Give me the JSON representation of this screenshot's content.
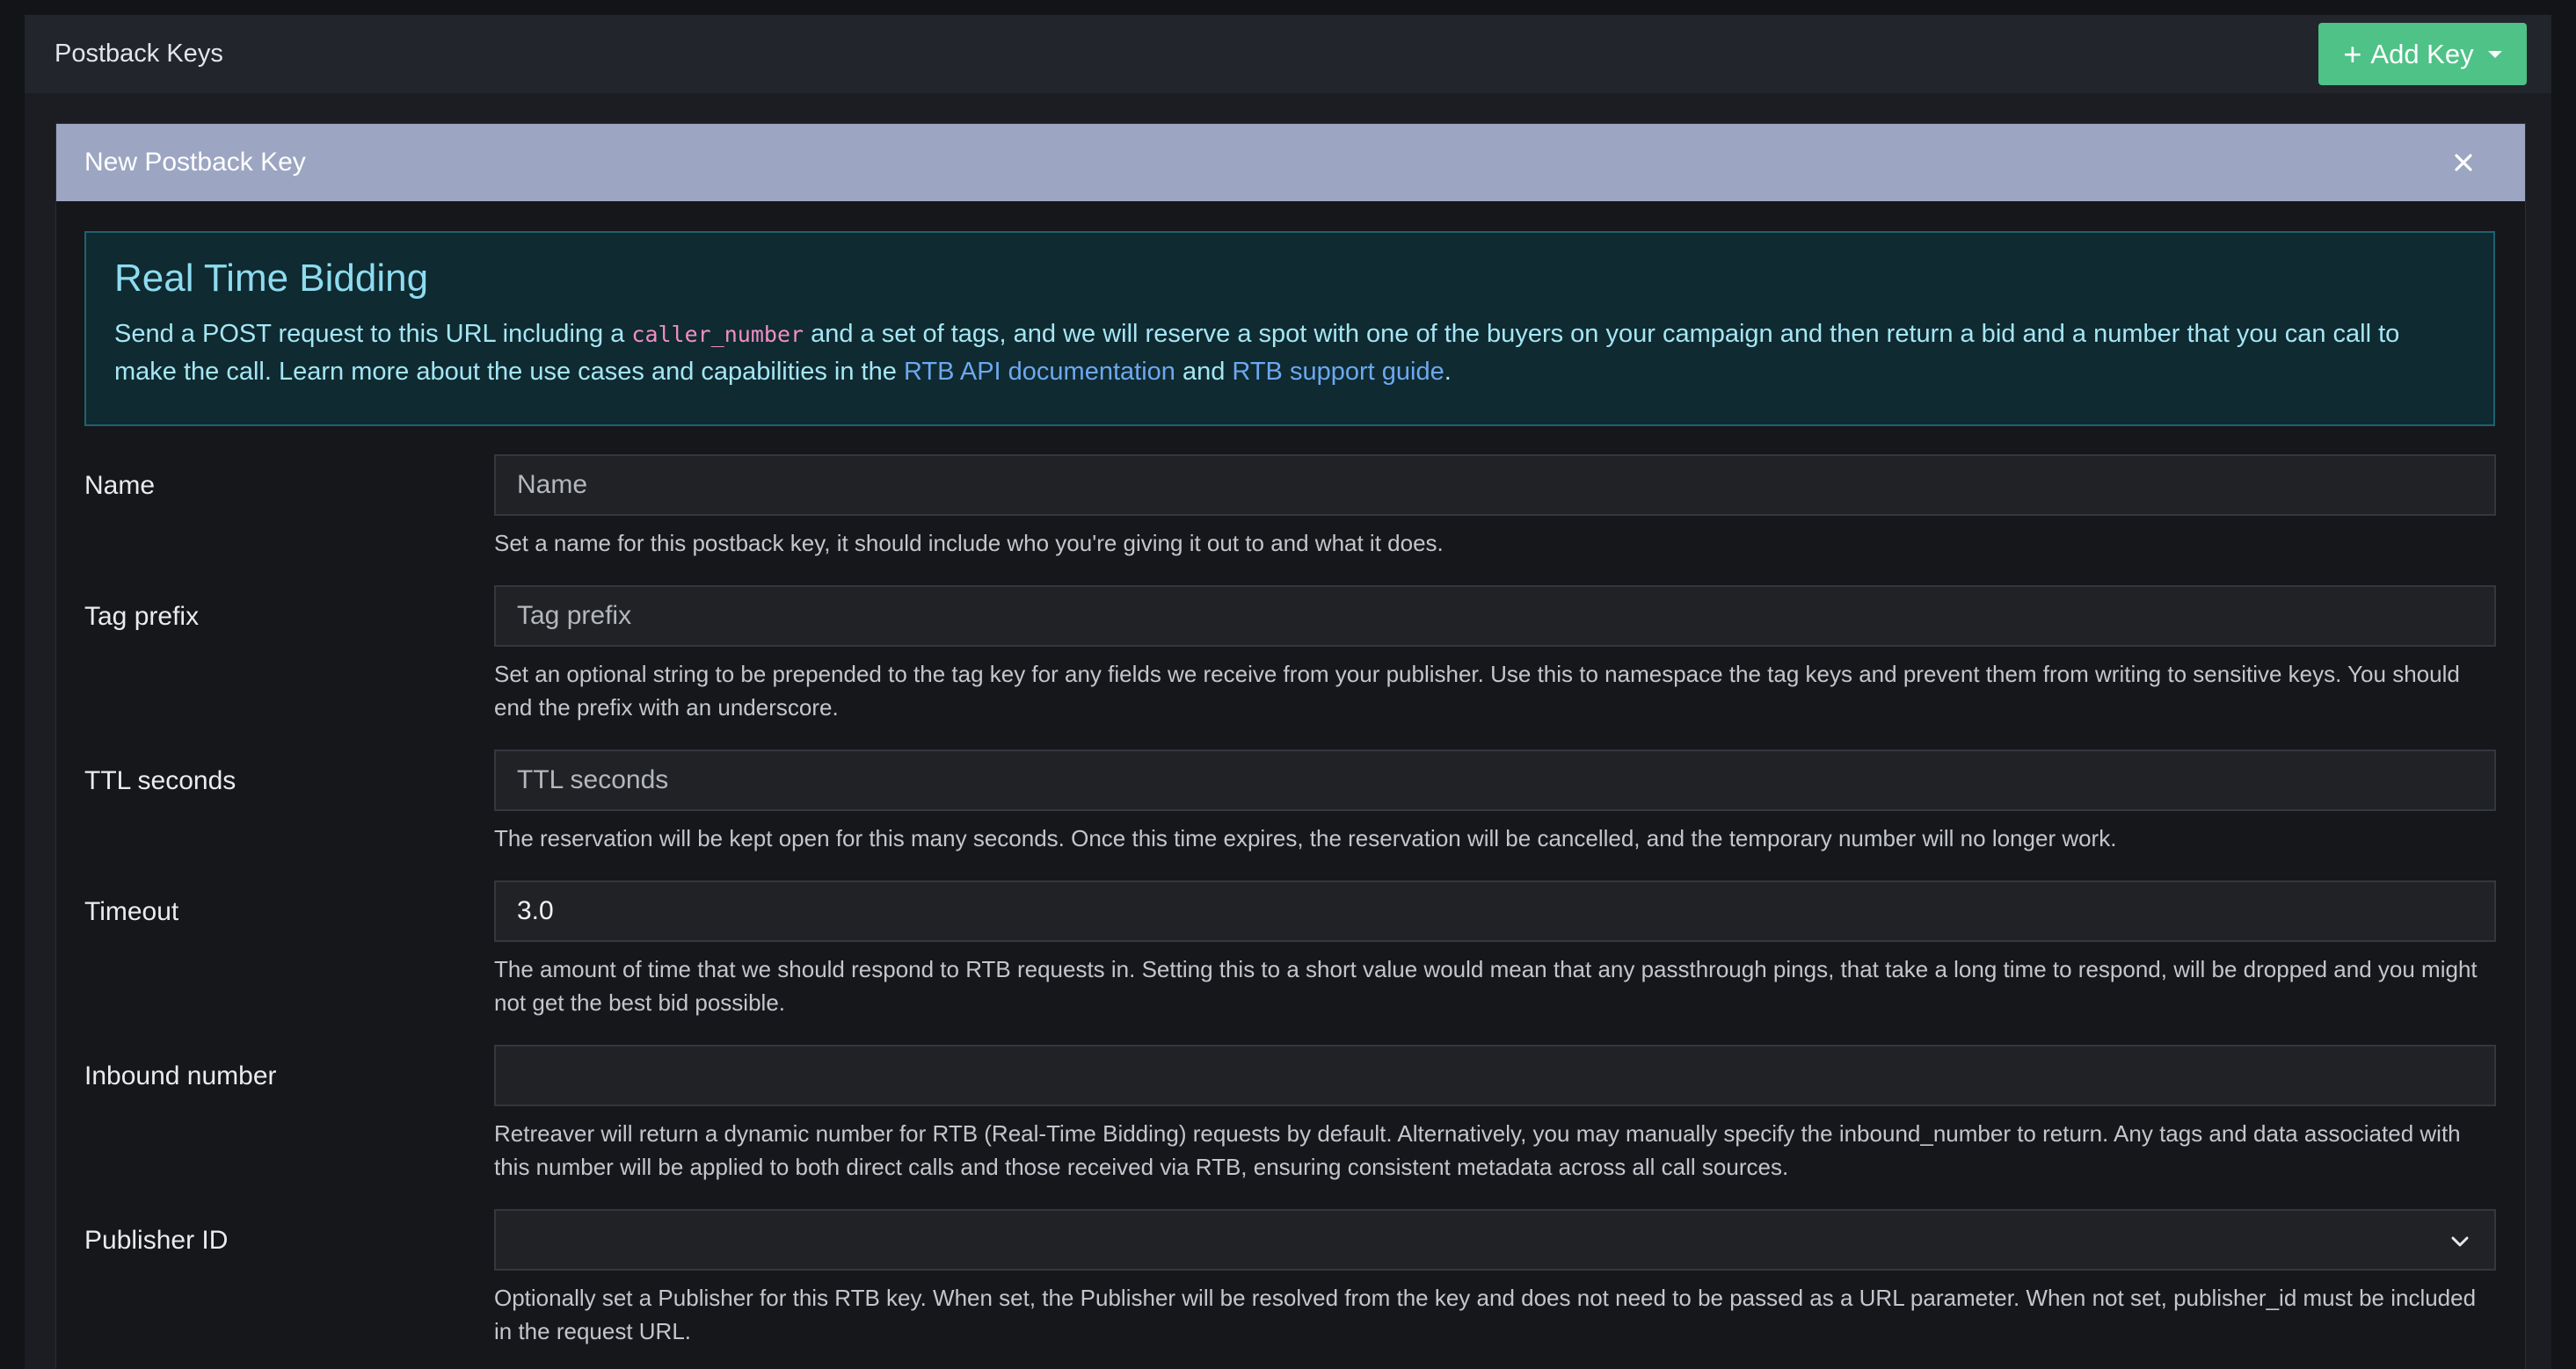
{
  "header": {
    "title": "Postback Keys",
    "add_key_label": "Add Key"
  },
  "panel": {
    "title": "New Postback Key"
  },
  "alert": {
    "title": "Real Time Bidding",
    "text_before_code": "Send a POST request to this URL including a ",
    "code": "caller_number",
    "text_after_code": " and a set of tags, and we will reserve a spot with one of the buyers on your campaign and then return a bid and a number that you can call to make the call. Learn more about the use cases and capabilities in the ",
    "link_api": "RTB API documentation",
    "text_and": " and ",
    "link_support": "RTB support guide",
    "text_end": "."
  },
  "form": {
    "name": {
      "label": "Name",
      "placeholder": "Name",
      "value": "",
      "help": "Set a name for this postback key, it should include who you're giving it out to and what it does."
    },
    "tag_prefix": {
      "label": "Tag prefix",
      "placeholder": "Tag prefix",
      "value": "",
      "help": "Set an optional string to be prepended to the tag key for any fields we receive from your publisher. Use this to namespace the tag keys and prevent them from writing to sensitive keys. You should end the prefix with an underscore."
    },
    "ttl_seconds": {
      "label": "TTL seconds",
      "placeholder": "TTL seconds",
      "value": "",
      "help": "The reservation will be kept open for this many seconds. Once this time expires, the reservation will be cancelled, and the temporary number will no longer work."
    },
    "timeout": {
      "label": "Timeout",
      "placeholder": "",
      "value": "3.0",
      "help": "The amount of time that we should respond to RTB requests in. Setting this to a short value would mean that any passthrough pings, that take a long time to respond, will be dropped and you might not get the best bid possible."
    },
    "inbound_number": {
      "label": "Inbound number",
      "placeholder": "",
      "value": "",
      "help": "Retreaver will return a dynamic number for RTB (Real-Time Bidding) requests by default. Alternatively, you may manually specify the inbound_number to return. Any tags and data associated with this number will be applied to both direct calls and those received via RTB, ensuring consistent metadata across all call sources."
    },
    "publisher_id": {
      "label": "Publisher ID",
      "selected": "",
      "help": "Optionally set a Publisher for this RTB key. When set, the Publisher will be resolved from the key and does not need to be passed as a URL parameter. When not set, publisher_id must be included in the request URL."
    }
  },
  "colors": {
    "accent_green": "#4ec287",
    "panel_header": "#9ca6c2",
    "alert_bg": "#0f2a30",
    "alert_text": "#a5e6f5",
    "link": "#6da8f0",
    "code": "#f08fc5"
  },
  "icons": {
    "add": "plus-icon",
    "dropdown": "caret-down-icon",
    "close": "close-icon",
    "select": "chevron-down-icon"
  }
}
